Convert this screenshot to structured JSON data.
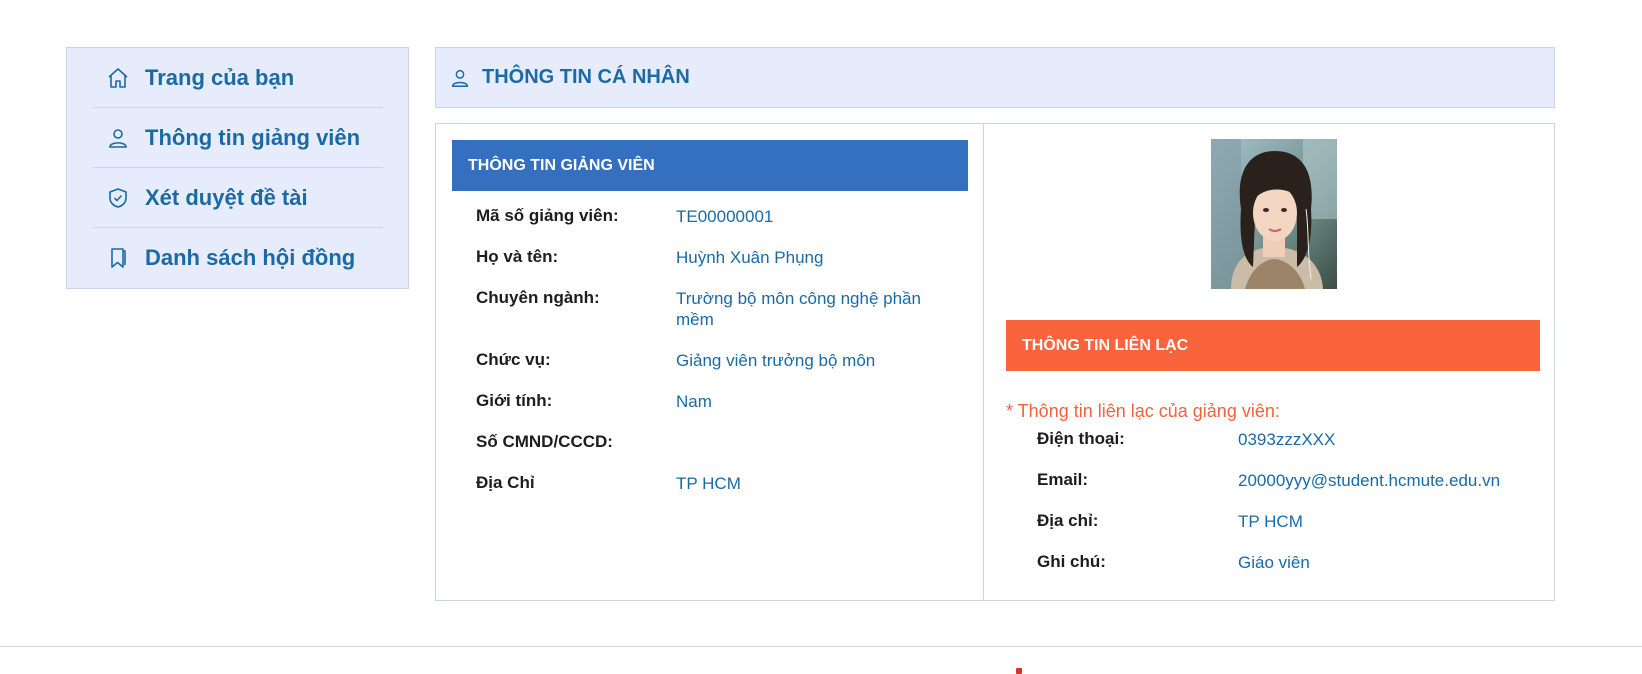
{
  "sidebar": {
    "items": [
      {
        "label": "Trang của bạn",
        "icon": "home-icon"
      },
      {
        "label": "Thông tin giảng viên",
        "icon": "user-icon"
      },
      {
        "label": "Xét duyệt đề tài",
        "icon": "shield-check-icon"
      },
      {
        "label": "Danh sách hội đồng",
        "icon": "bookmark-icon"
      }
    ]
  },
  "header": {
    "title": "THÔNG TIN CÁ NHÂN",
    "icon": "user-icon"
  },
  "lecturer_info": {
    "title": "THÔNG TIN GIẢNG VIÊN",
    "fields": [
      {
        "label": "Mã số giảng viên:",
        "value": "TE00000001"
      },
      {
        "label": "Họ và tên:",
        "value": "Huỳnh Xuân Phụng"
      },
      {
        "label": "Chuyên ngành:",
        "value": "Trường bộ môn công nghệ phần mềm"
      },
      {
        "label": "Chức vụ:",
        "value": "Giảng viên trưởng bộ môn"
      },
      {
        "label": "Giới tính:",
        "value": "Nam"
      },
      {
        "label": "Số CMND/CCCD:",
        "value": ""
      },
      {
        "label": "Địa Chỉ",
        "value": "TP HCM"
      }
    ]
  },
  "contact_info": {
    "title": "THÔNG TIN LIÊN LẠC",
    "note": "* Thông tin liên lạc của giảng viên:",
    "fields": [
      {
        "label": "Điện thoại:",
        "value": "0393zzzXXX"
      },
      {
        "label": "Email:",
        "value": "20000yyy@student.hcmute.edu.vn"
      },
      {
        "label": "Địa chỉ:",
        "value": "TP HCM"
      },
      {
        "label": "Ghi chú:",
        "value": "Giáo viên"
      }
    ]
  },
  "colors": {
    "accent_blue": "#356fbf",
    "accent_orange": "#fa643c",
    "link_blue": "#1a6aa6",
    "panel_bg": "#e6ecfb"
  }
}
